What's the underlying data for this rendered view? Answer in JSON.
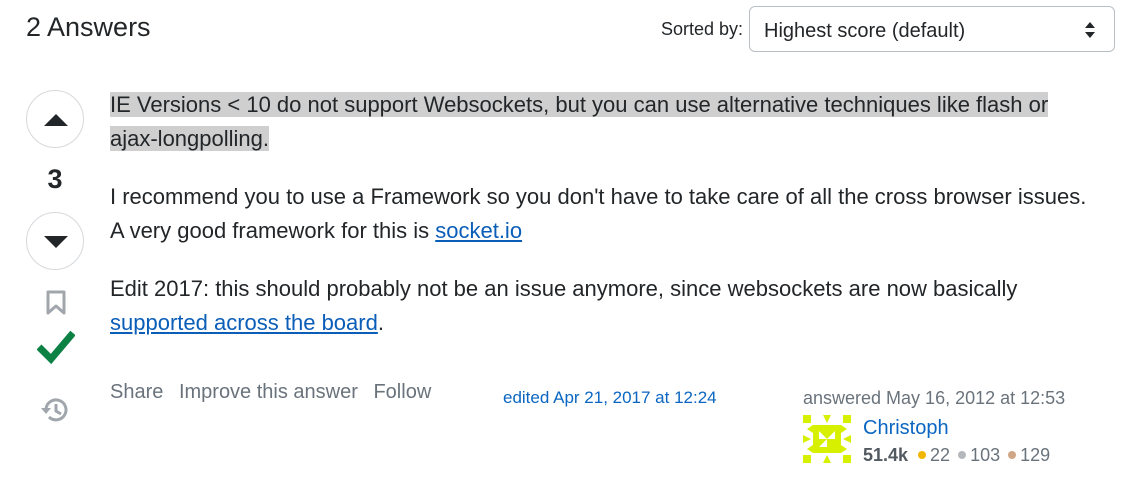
{
  "header": {
    "answers_title": "2 Answers",
    "sorted_label": "Sorted by:",
    "sort_value": "Highest score (default)"
  },
  "vote": {
    "count": "3"
  },
  "post": {
    "p1": "IE Versions < 10 do not support Websockets, but you can use alternative techniques like flash or ajax-longpolling.",
    "p2_text": "I recommend you to use a Framework so you don't have to take care of all the cross browser issues. A very good framework for this is ",
    "p2_link": "socket.io",
    "p3_text": "Edit 2017: this should probably not be an issue anymore, since websockets are now basically ",
    "p3_link": "supported across the board",
    "p3_end": "."
  },
  "actions": {
    "share": "Share",
    "improve": "Improve this answer",
    "follow": "Follow"
  },
  "edited": "edited Apr 21, 2017 at 12:24",
  "answered": "answered May 16, 2012 at 12:53",
  "user": {
    "name": "Christoph",
    "reputation": "51.4k",
    "gold": "22",
    "silver": "103",
    "bronze": "129"
  },
  "icons": {
    "vote_up": "triangle-up-icon",
    "vote_down": "triangle-down-icon",
    "bookmark": "bookmark-icon",
    "accepted": "checkmark-icon",
    "history": "history-icon",
    "sort": "sort-arrows-icon"
  },
  "colors": {
    "accepted_green": "#0b8144",
    "link_blue": "#0a5eb8",
    "highlight": "#cfcfcf"
  }
}
